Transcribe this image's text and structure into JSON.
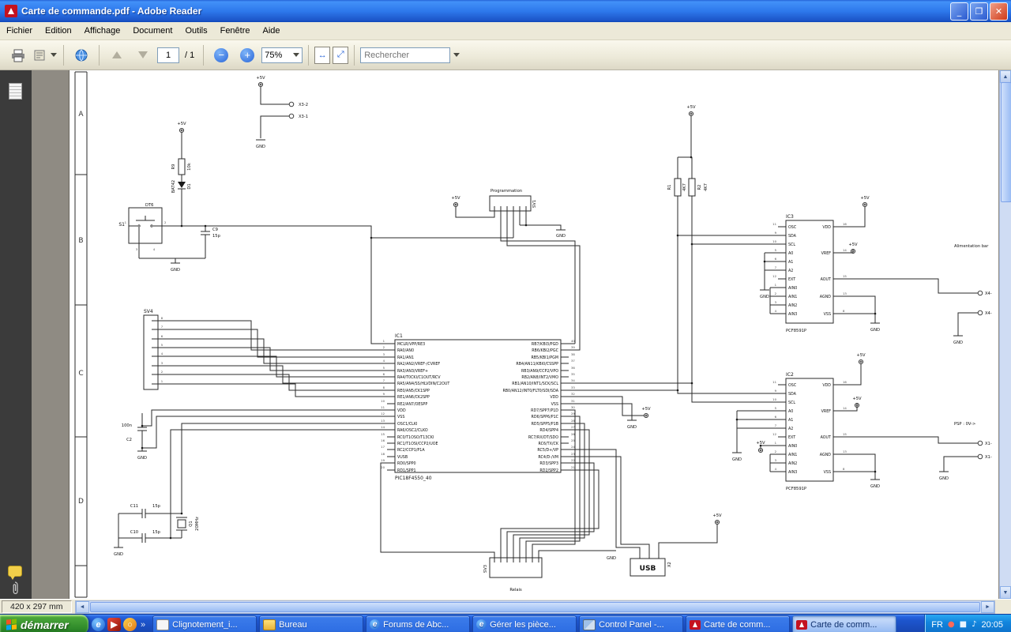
{
  "window": {
    "title": "Carte de commande.pdf - Adobe Reader"
  },
  "menu": {
    "items": [
      "Fichier",
      "Edition",
      "Affichage",
      "Document",
      "Outils",
      "Fenêtre",
      "Aide"
    ]
  },
  "toolbar": {
    "page_value": "1",
    "page_total": "/ 1",
    "zoom_value": "75%",
    "search_placeholder": "Rechercher"
  },
  "statusbar": {
    "page_size": "420 x 297 mm"
  },
  "taskbar": {
    "start": "démarrer",
    "overflow": "»",
    "tasks": [
      "Clignotement_i...",
      "Bureau",
      "Forums de Abc...",
      "Gérer les pièce...",
      "Control Panel -...",
      "Carte de comm...",
      "Carte de comm..."
    ],
    "tray": {
      "lang": "FR",
      "time": "20:05"
    }
  },
  "schematic": {
    "rows": [
      "A",
      "B",
      "C",
      "D"
    ],
    "sym": {
      "p5v": "+5V",
      "gnd": "GND"
    },
    "conn": {
      "x32": "X3-2",
      "x31": "X3-1",
      "x4": "X4-",
      "x1": "X1-",
      "x2": "X2",
      "usb": "USB"
    },
    "notes": {
      "alim": "Alimentation bar",
      "psp": "PSP : 0V->",
      "prog": "Programmation",
      "relais": "Relais"
    },
    "parts": {
      "s1": {
        "ref": "S1",
        "val": "DT6",
        "pins": [
          "1",
          "2",
          "3",
          "4"
        ]
      },
      "r9": {
        "ref": "R9",
        "val": "10k"
      },
      "d1": {
        "ref": "D1",
        "val": "BAT42"
      },
      "c9": {
        "ref": "C9",
        "val": "15p"
      },
      "c2": {
        "ref": "C2",
        "val": "100n"
      },
      "c10": {
        "ref": "C10",
        "val": "15p"
      },
      "c11": {
        "ref": "C11",
        "val": "15p"
      },
      "q1": {
        "ref": "Q1",
        "val": "20MHz"
      },
      "r1": {
        "ref": "R1",
        "val": "4K7"
      },
      "r2": {
        "ref": "R2",
        "val": "4K7"
      },
      "sv1": {
        "ref": "SV1"
      },
      "sv3": {
        "ref": "SV3"
      },
      "sv4": {
        "ref": "SV4",
        "nums": [
          "8",
          "7",
          "6",
          "5",
          "4",
          "3",
          "2",
          "1"
        ]
      },
      "ic1": {
        "ref": "IC1",
        "part": "PIC18F4550_40",
        "left": [
          {
            "n": "1",
            "l": "MCLR/VPP/RE3"
          },
          {
            "n": "2",
            "l": "RA0/AN0"
          },
          {
            "n": "3",
            "l": "RA1/AN1"
          },
          {
            "n": "4",
            "l": "RA2/AN2/VREF-/CVREF"
          },
          {
            "n": "5",
            "l": "RA3/AN3/VREF+"
          },
          {
            "n": "6",
            "l": "RA4/T0CKI/C1OUT/RCV"
          },
          {
            "n": "7",
            "l": "RA5/AN4/SS/HLVDIN/C2OUT"
          },
          {
            "n": "8",
            "l": "RE0/AN5/CK1SPP"
          },
          {
            "n": "9",
            "l": "RE1/AN6/CK2SPP"
          },
          {
            "n": "10",
            "l": "RE2/AN7/OESPP"
          },
          {
            "n": "11",
            "l": "VDD"
          },
          {
            "n": "12",
            "l": "VSS"
          },
          {
            "n": "13",
            "l": "OSC1/CLKI"
          },
          {
            "n": "14",
            "l": "RA6/OSC2/CLKO"
          },
          {
            "n": "15",
            "l": "RC0/T1OSO/T13CKI"
          },
          {
            "n": "16",
            "l": "RC1/T1OSI/CCP2/UOE"
          },
          {
            "n": "17",
            "l": "RC2/CCP1/P1A"
          },
          {
            "n": "18",
            "l": "VUSB"
          },
          {
            "n": "19",
            "l": "RD0/SPP0"
          },
          {
            "n": "20",
            "l": "RD1/SPP1"
          }
        ],
        "right": [
          {
            "n": "40",
            "l": "RB7/KBI3/PGD"
          },
          {
            "n": "39",
            "l": "RB6/KBI2/PGC"
          },
          {
            "n": "38",
            "l": "RB5/KBI1/PGM"
          },
          {
            "n": "37",
            "l": "RB4/AN11/KBI0/CSSPP"
          },
          {
            "n": "36",
            "l": "RB3/AN9/CCP2/VPO"
          },
          {
            "n": "35",
            "l": "RB2/AN8/INT2/VMO"
          },
          {
            "n": "34",
            "l": "RB1/AN10/INT1/SCK/SCL"
          },
          {
            "n": "33",
            "l": "RB0/AN12/INT0/FLT0/SDI/SDA"
          },
          {
            "n": "32",
            "l": "VDD"
          },
          {
            "n": "31",
            "l": "VSS"
          },
          {
            "n": "30",
            "l": "RD7/SPP7/P1D"
          },
          {
            "n": "29",
            "l": "RD6/SPP6/P1C"
          },
          {
            "n": "28",
            "l": "RD5/SPP5/P1B"
          },
          {
            "n": "27",
            "l": "RD4/SPP4"
          },
          {
            "n": "26",
            "l": "RC7/RX/DT/SDO"
          },
          {
            "n": "25",
            "l": "RC6/TX/CK"
          },
          {
            "n": "24",
            "l": "RC5/D+/VP"
          },
          {
            "n": "23",
            "l": "RC4/D-/VM"
          },
          {
            "n": "22",
            "l": "RD3/SPP3"
          },
          {
            "n": "21",
            "l": "RD2/SPP2"
          }
        ]
      },
      "ic2": {
        "ref": "IC2",
        "part": "PCF8591P"
      },
      "ic3": {
        "ref": "IC3",
        "part": "PCF8591P"
      },
      "pcf": {
        "left": [
          {
            "n": "11",
            "l": "OSC"
          },
          {
            "n": "9",
            "l": "SDA"
          },
          {
            "n": "10",
            "l": "SCL"
          },
          {
            "n": "5",
            "l": "A0"
          },
          {
            "n": "6",
            "l": "A1"
          },
          {
            "n": "7",
            "l": "A2"
          },
          {
            "n": "12",
            "l": "EXT"
          },
          {
            "n": "1",
            "l": "AIN0"
          },
          {
            "n": "2",
            "l": "AIN1"
          },
          {
            "n": "3",
            "l": "AIN2"
          },
          {
            "n": "4",
            "l": "AIN3"
          }
        ],
        "right": [
          {
            "n": "16",
            "l": "VDD"
          },
          {
            "n": "14",
            "l": "VREF"
          },
          {
            "n": "15",
            "l": "AOUT"
          },
          {
            "n": "13",
            "l": "AGND"
          },
          {
            "n": "8",
            "l": "VSS"
          }
        ]
      }
    }
  }
}
